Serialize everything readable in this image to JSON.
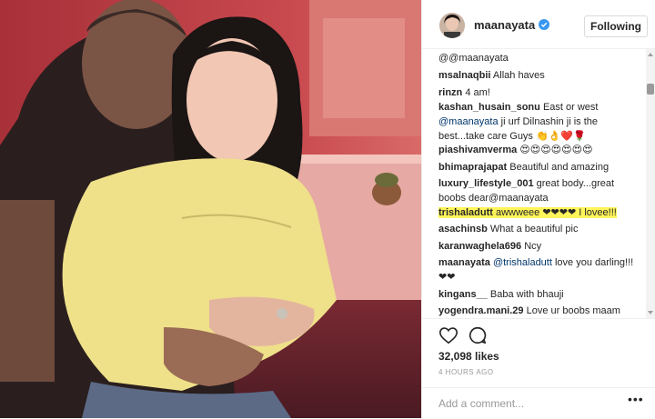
{
  "post": {
    "username": "maanayata",
    "follow_label": "Following",
    "likes": "32,098 likes",
    "time": "4 HOURS AGO",
    "add_comment_placeholder": "Add a comment...",
    "more_label": "•••"
  },
  "colors": {
    "accent": "#3897f0",
    "highlight": "#fff55a",
    "mention": "#003569"
  },
  "icons": [
    "verified-badge-icon",
    "heart-icon",
    "comment-bubble-icon",
    "more-options-icon",
    "scroll-up-arrow-icon",
    "scroll-down-arrow-icon"
  ],
  "comments": [
    {
      "user": "",
      "text": "@@maanayata"
    },
    {
      "user": "msalnaqbii",
      "text": "Allah haves"
    },
    {
      "user": "rinzn",
      "text": "4 am!"
    },
    {
      "user": "kashan_husain_sonu",
      "text": "East or west",
      "mention": "@maanayata",
      "text_after": "ji urf Dilnashin ji is the best...take care Guys 👏👌❤️🌹"
    },
    {
      "user": "piashivamverma",
      "text": "😍😍😍😍😍😍😍"
    },
    {
      "user": "bhimaprajapat",
      "text": "Beautiful and amazing"
    },
    {
      "user": "luxury_lifestyle_001",
      "text": "great body...great boobs dear@maanayata"
    },
    {
      "user": "trishaladutt",
      "text": "awwweee ❤❤❤❤ I lovee!!!"
    },
    {
      "user": "asachinsb",
      "text": "What a beautiful pic"
    },
    {
      "user": "karanwaghela696",
      "text": "Ncy"
    },
    {
      "user": "maanayata",
      "mention": "@trishaladutt",
      "text_after": "love you darling!!! ❤❤"
    },
    {
      "user": "kingans__",
      "text": "Baba with bhauji"
    },
    {
      "user": "yogendra.mani.29",
      "text": "Love ur boobs maam"
    }
  ]
}
